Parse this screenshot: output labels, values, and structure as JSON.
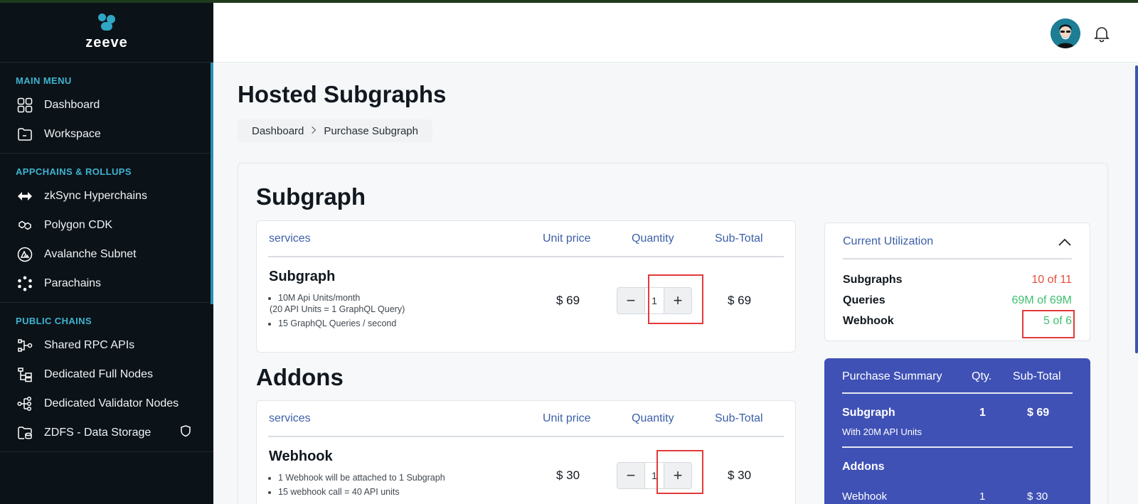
{
  "brand": {
    "name": "zeeve"
  },
  "sidebar": {
    "sections": [
      {
        "title": "MAIN MENU",
        "items": [
          {
            "label": "Dashboard",
            "icon": "grid-icon"
          },
          {
            "label": "Workspace",
            "icon": "folder-icon"
          }
        ]
      },
      {
        "title": "APPCHAINS & ROLLUPS",
        "items": [
          {
            "label": "zkSync Hyperchains",
            "icon": "arrows-icon"
          },
          {
            "label": "Polygon CDK",
            "icon": "polygon-icon"
          },
          {
            "label": "Avalanche Subnet",
            "icon": "avalanche-icon"
          },
          {
            "label": "Parachains",
            "icon": "parachain-icon"
          }
        ]
      },
      {
        "title": "PUBLIC CHAINS",
        "items": [
          {
            "label": "Shared RPC APIs",
            "icon": "rpc-icon"
          },
          {
            "label": "Dedicated Full Nodes",
            "icon": "nodes-tree-icon"
          },
          {
            "label": "Dedicated Validator Nodes",
            "icon": "validator-icon"
          },
          {
            "label": "ZDFS - Data Storage",
            "icon": "storage-icon"
          }
        ]
      }
    ]
  },
  "page": {
    "title": "Hosted Subgraphs",
    "breadcrumb": [
      "Dashboard",
      "Purchase Subgraph"
    ]
  },
  "subgraph_section": {
    "title": "Subgraph",
    "headers": [
      "services",
      "Unit price",
      "Quantity",
      "Sub-Total"
    ],
    "item": {
      "name": "Subgraph",
      "bullets": [
        "10M Api Units/month",
        "(20 API Units = 1 GraphQL Query)",
        "15 GraphQL Queries / second"
      ],
      "unit_price": "$ 69",
      "quantity": "1",
      "subtotal": "$ 69"
    }
  },
  "addons_section": {
    "title": "Addons",
    "headers": [
      "services",
      "Unit price",
      "Quantity",
      "Sub-Total"
    ],
    "item": {
      "name": "Webhook",
      "bullets": [
        "1 Webhook will be attached to 1 Subgraph",
        "15 webhook call = 40 API units"
      ],
      "unit_price": "$ 30",
      "quantity": "1",
      "subtotal": "$ 30"
    }
  },
  "utilization": {
    "title": "Current Utilization",
    "rows": [
      {
        "label": "Subgraphs",
        "value": "10 of 11",
        "color": "#e0503c"
      },
      {
        "label": "Queries",
        "value": "69M of 69M",
        "color": "#3fbf6f"
      },
      {
        "label": "Webhook",
        "value": "5 of 6",
        "color": "#3fbf6f"
      }
    ]
  },
  "summary": {
    "headers": [
      "Purchase Summary",
      "Qty.",
      "Sub-Total"
    ],
    "subgraph": {
      "name": "Subgraph",
      "qty": "1",
      "subtotal": "$ 69",
      "note": "With 20M API Units"
    },
    "addons_title": "Addons",
    "webhook": {
      "name": "Webhook",
      "qty": "1",
      "subtotal": "$ 30"
    }
  },
  "colors": {
    "accent": "#3fb3cf",
    "summary_bg": "#3f51b5",
    "sidebar_bg": "#0b1218"
  }
}
